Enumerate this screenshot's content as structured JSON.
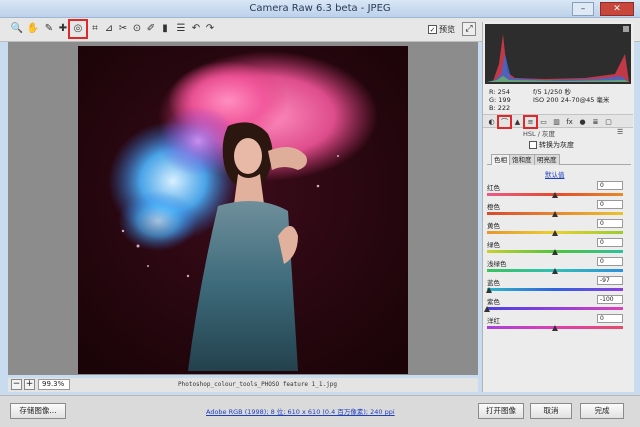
{
  "window": {
    "title": "Camera Raw 6.3 beta -  JPEG",
    "minimize": "–",
    "maximize": "□",
    "close": "✕"
  },
  "toolbar": {
    "tools": [
      {
        "icon": "zoom-icon",
        "glyph": "🔍"
      },
      {
        "icon": "hand-icon",
        "glyph": "✋"
      },
      {
        "icon": "white-balance-icon",
        "glyph": "✎"
      },
      {
        "icon": "color-sampler-icon",
        "glyph": "✚"
      },
      {
        "icon": "targeted-adjustment-icon",
        "glyph": "◎"
      },
      {
        "icon": "crop-icon",
        "glyph": "⌗"
      },
      {
        "icon": "straighten-icon",
        "glyph": "⊿"
      },
      {
        "icon": "spot-removal-icon",
        "glyph": "✂"
      },
      {
        "icon": "red-eye-icon",
        "glyph": "⊙"
      },
      {
        "icon": "adjustment-brush-icon",
        "glyph": "✐"
      },
      {
        "icon": "graduated-filter-icon",
        "glyph": "▮"
      },
      {
        "icon": "preferences-icon",
        "glyph": "☰"
      },
      {
        "icon": "rotate-left-icon",
        "glyph": "↶"
      },
      {
        "icon": "rotate-right-icon",
        "glyph": "↷"
      }
    ],
    "preview_label": "预览",
    "preview_checked": true,
    "fullscreen": "⤢"
  },
  "status": {
    "zoom_out": "−",
    "zoom_in": "+",
    "zoom_value": "99.3%",
    "filename": "Photoshop_colour_tools_PHOSO feature 1_1.jpg"
  },
  "bottom": {
    "save_label": "存储图像...",
    "workflow_link": "Adobe RGB (1998); 8 位; 610 x 610 (0.4 百万像素); 240 ppi",
    "open_label": "打开图像",
    "cancel_label": "取消",
    "done_label": "完成"
  },
  "readout": {
    "r": "R:  254",
    "g": "G:  199",
    "b": "B:  222",
    "exposure": "f/5    1/250 秒",
    "iso": "ISO 200    24-70@45 毫米"
  },
  "panel": {
    "tabs": [
      {
        "icon": "basic-icon",
        "glyph": "◐"
      },
      {
        "icon": "tone-curve-icon",
        "glyph": "⌒"
      },
      {
        "icon": "detail-icon",
        "glyph": "▲"
      },
      {
        "icon": "hsl-icon",
        "glyph": "≡"
      },
      {
        "icon": "split-toning-icon",
        "glyph": "▭"
      },
      {
        "icon": "lens-corrections-icon",
        "glyph": "▥"
      },
      {
        "icon": "effects-icon",
        "glyph": "fx"
      },
      {
        "icon": "camera-calibration-icon",
        "glyph": "●"
      },
      {
        "icon": "presets-icon",
        "glyph": "≣"
      },
      {
        "icon": "snapshots-icon",
        "glyph": "▢"
      }
    ],
    "heading": "HSL / 灰度",
    "menu": "☰",
    "grayscale_label": "转换为灰度",
    "subtabs": [
      "色相",
      "饱和度",
      "明亮度"
    ],
    "default_link": "默认值",
    "sliders": [
      {
        "label": "红色",
        "value": "0",
        "pos": 0.5,
        "gradient": [
          "#e85b87",
          "#e54a2a",
          "#e58a2a"
        ]
      },
      {
        "label": "橙色",
        "value": "0",
        "pos": 0.5,
        "gradient": [
          "#d8492f",
          "#e8862f",
          "#e8c42f"
        ]
      },
      {
        "label": "黄色",
        "value": "0",
        "pos": 0.5,
        "gradient": [
          "#e8962f",
          "#e8d02f",
          "#9acb2f"
        ]
      },
      {
        "label": "绿色",
        "value": "0",
        "pos": 0.5,
        "gradient": [
          "#c9cf2f",
          "#4fc43b",
          "#2fbf9e"
        ]
      },
      {
        "label": "浅绿色",
        "value": "0",
        "pos": 0.5,
        "gradient": [
          "#3bc25d",
          "#2fc0b8",
          "#2f8fdf"
        ]
      },
      {
        "label": "蓝色",
        "value": "-97",
        "pos": 0.015,
        "gradient": [
          "#2fb8c8",
          "#2f62df",
          "#8a3fdf"
        ]
      },
      {
        "label": "紫色",
        "value": "-100",
        "pos": 0.0,
        "gradient": [
          "#4a3fdf",
          "#8d3fdf",
          "#df3fb8"
        ]
      },
      {
        "label": "洋红",
        "value": "0",
        "pos": 0.5,
        "gradient": [
          "#a83fdf",
          "#df3fb0",
          "#e84b6b"
        ]
      }
    ]
  },
  "colors": {
    "highlight": "#e0282a",
    "link": "#1f3fbf"
  }
}
